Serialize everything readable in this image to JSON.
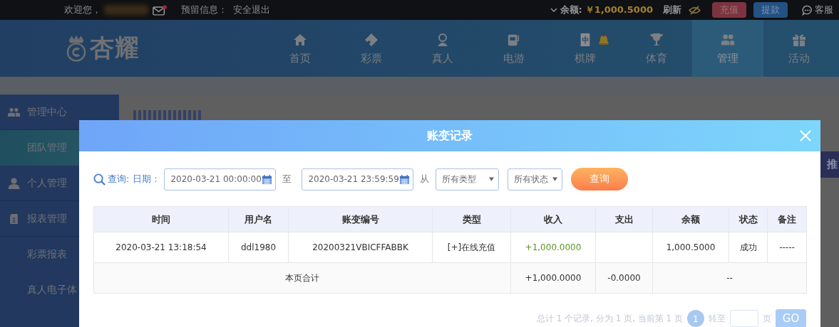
{
  "top_bar": {
    "welcome": "欢迎您，",
    "mail_unread": true,
    "reserved_info": "预留信息：",
    "logout": "安全退出",
    "balance_label": "余额:",
    "balance": "￥1,000.5000",
    "refresh": "刷新",
    "deposit": "充值",
    "withdraw": "提款",
    "support": "客服"
  },
  "logo": {
    "text": "杏耀"
  },
  "nav": {
    "items": [
      {
        "label": "首页",
        "selected": false,
        "badge": false
      },
      {
        "label": "彩票",
        "selected": false,
        "badge": false
      },
      {
        "label": "真人",
        "selected": false,
        "badge": false
      },
      {
        "label": "电游",
        "selected": false,
        "badge": false
      },
      {
        "label": "棋牌",
        "selected": false,
        "badge": true
      },
      {
        "label": "体育",
        "selected": false,
        "badge": false
      },
      {
        "label": "管理",
        "selected": true,
        "badge": false
      },
      {
        "label": "活动",
        "selected": false,
        "badge": false
      }
    ]
  },
  "sidebar": {
    "items": [
      {
        "label": "管理中心",
        "kind": "section",
        "selected": false
      },
      {
        "label": "团队管理",
        "kind": "sub",
        "selected": true
      },
      {
        "label": "个人管理",
        "kind": "section",
        "selected": false
      },
      {
        "label": "报表管理",
        "kind": "section",
        "selected": false
      },
      {
        "label": "彩票报表",
        "kind": "sub",
        "selected": false
      },
      {
        "label": "真人电子体",
        "kind": "sub",
        "selected": false
      }
    ]
  },
  "side_tab": "推",
  "modal": {
    "title": "账变记录",
    "filter": {
      "query_label": "查询:",
      "date_label": "日期：",
      "start": "2020-03-21 00:00:00",
      "separator": "至",
      "end": "2020-03-21 23:59:59",
      "from_label": "从",
      "type_select": "所有类型",
      "status_select": "所有状态",
      "query_button": "查询"
    },
    "table": {
      "columns": [
        "时间",
        "用户名",
        "账变编号",
        "类型",
        "收入",
        "支出",
        "余额",
        "状态",
        "备注"
      ],
      "rows": [
        {
          "kind": "record",
          "cells": [
            "2020-03-21 13:18:54",
            "ddl1980",
            "20200321VBICFFABBK",
            "[+]在线充值",
            "+1,000.0000",
            "",
            "1,000.5000",
            "成功",
            "-----"
          ]
        },
        {
          "kind": "total",
          "label": "本页合计",
          "income": "+1,000.0000",
          "expense": "-0.0000",
          "balance": "--"
        }
      ]
    },
    "pagination": {
      "summary": "总计 1 个记录, 分为 1 页, 当前第 1 页",
      "pages": [
        {
          "label": "1",
          "selected": true
        }
      ],
      "goto_label": "转至",
      "page_unit": "页",
      "go_button": "GO"
    }
  }
}
